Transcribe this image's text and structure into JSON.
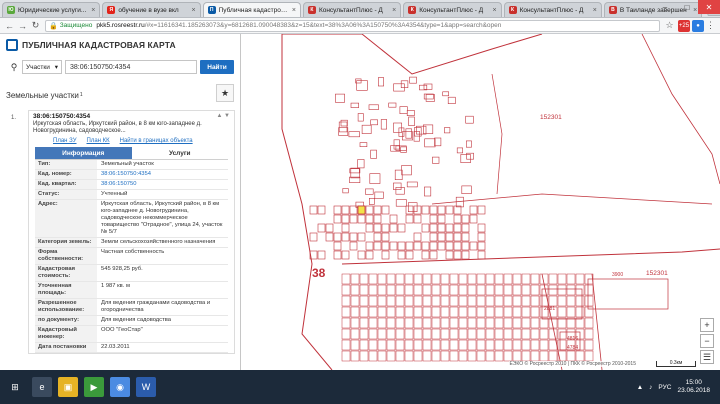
{
  "browser": {
    "tabs": [
      {
        "label": "Юридические услуги...",
        "fav_color": "#5aa83c",
        "fav_text": "Ю",
        "active": false
      },
      {
        "label": "обучение в вузе вкл",
        "fav_color": "#e2231a",
        "fav_text": "Я",
        "active": false
      },
      {
        "label": "Публичная кадастровая",
        "fav_color": "#0a5aa6",
        "fav_text": "П",
        "active": true
      },
      {
        "label": "КонсультантПлюс - Д",
        "fav_color": "#c9302c",
        "fav_text": "К",
        "active": false
      },
      {
        "label": "КонсультантПлюс - Д",
        "fav_color": "#c9302c",
        "fav_text": "К",
        "active": false
      },
      {
        "label": "КонсультантПлюс - Д",
        "fav_color": "#c9302c",
        "fav_text": "К",
        "active": false
      },
      {
        "label": "В Таиланде завершен",
        "fav_color": "#c9302c",
        "fav_text": "В",
        "active": false
      }
    ],
    "secure_label": "Защищено",
    "url_host": "pkk5.rosreestr.ru",
    "url_path": "/#x=11616341.185263073&y=6812681.090048383&z=15&text=38%3A06%3A150750%3A4354&type=1&app=search&open",
    "ext_badge": "+25"
  },
  "panel": {
    "title": "ПУБЛИЧНАЯ КАДАСТРОВАЯ КАРТА",
    "search": {
      "type_value": "Участки",
      "query": "38:06:150750:4354",
      "find_label": "Найти"
    },
    "results_title": "Земельные участки",
    "results_count": "1",
    "card": {
      "number": "1.",
      "cad_number": "38:06:150750:4354",
      "address": "Иркутская область, Иркутский район, в 8 км юго-западнее д. Новогрудинина, садоводческое...",
      "link_plan_zu": "План ЗУ",
      "link_plan_kk": "План КК",
      "link_find_obj": "Найти в границах объекта"
    },
    "info_tabs": {
      "info": "Информация",
      "services": "Услуги"
    },
    "rows": [
      {
        "k": "Тип:",
        "v": "Земельный участок",
        "link": false
      },
      {
        "k": "Кад. номер:",
        "v": "38:06:150750:4354",
        "link": true
      },
      {
        "k": "Кад. квартал:",
        "v": "38:06:150750",
        "link": true
      },
      {
        "k": "Статус:",
        "v": "Учтенный",
        "link": false
      },
      {
        "k": "Адрес:",
        "v": "Иркутская область, Иркутский район, в 8 км юго-западнее д. Новогрудинина, садоводческое некоммерческое товарищество \"Отрадное\", улица 24, участок № 5/7",
        "link": false
      },
      {
        "k": "Категория земель:",
        "v": "Земли сельскохозяйственного назначения",
        "link": false
      },
      {
        "k": "Форма собственности:",
        "v": "Частная собственность",
        "link": false
      },
      {
        "k": "Кадастровая стоимость:",
        "v": "545 928,25 руб.",
        "link": false
      },
      {
        "k": "Уточненная площадь:",
        "v": "1 987 кв. м",
        "link": false
      },
      {
        "k": "Разрешенное использование:",
        "v": "Для ведения гражданами садоводства и огородничества",
        "link": false
      },
      {
        "k": "по документу:",
        "v": "Для ведения садоводства",
        "link": false
      },
      {
        "k": "Кадастровый инженер:",
        "v": "ООО \"ГеоСтар\"",
        "link": false
      },
      {
        "k": "Дата постановки",
        "v": "22.03.2011",
        "link": false
      }
    ]
  },
  "map": {
    "labels": {
      "big": "38",
      "q1": "152301",
      "q2": "152301",
      "n3900": "3900",
      "n2881": "2881",
      "n4816": "4816",
      "n4784": "4784"
    },
    "attribution": "ЕЭКО © Росреестр 2010 | ПКК © Росреестр 2010-2015",
    "scale": "0.3км",
    "colors": {
      "parcel": "#c0323b",
      "selected": "#f2e34a"
    }
  },
  "taskbar": {
    "lang": "РУС",
    "time": "15:00",
    "date": "23.06.2018"
  }
}
